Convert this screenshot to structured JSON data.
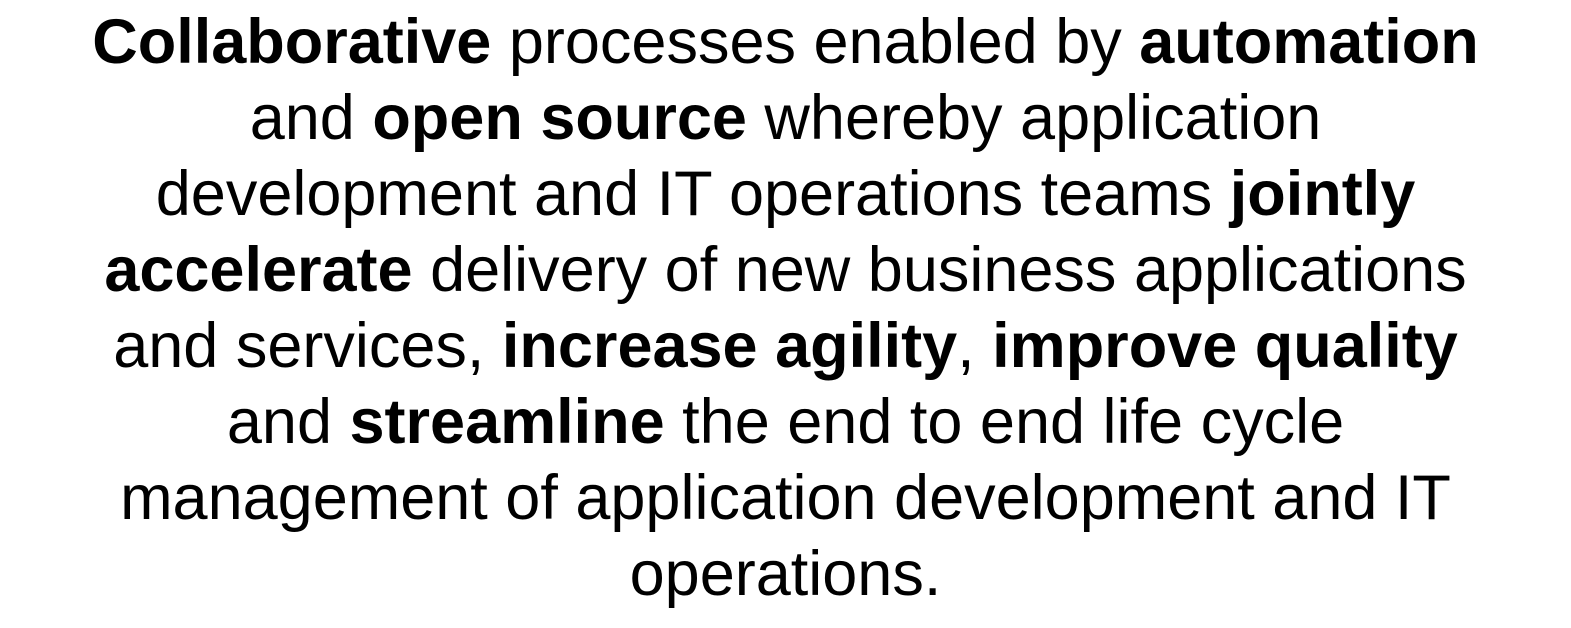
{
  "paragraph": {
    "lines": [
      [
        {
          "text": "Collaborative",
          "bold": true
        },
        {
          "text": " processes enabled by ",
          "bold": false
        },
        {
          "text": "automation",
          "bold": true
        }
      ],
      [
        {
          "text": "and ",
          "bold": false
        },
        {
          "text": "open source",
          "bold": true
        },
        {
          "text": " whereby application",
          "bold": false
        }
      ],
      [
        {
          "text": "development and IT operations teams ",
          "bold": false
        },
        {
          "text": "jointly",
          "bold": true
        }
      ],
      [
        {
          "text": "accelerate",
          "bold": true
        },
        {
          "text": " delivery of new business applications",
          "bold": false
        }
      ],
      [
        {
          "text": "and services, ",
          "bold": false
        },
        {
          "text": "increase agility",
          "bold": true
        },
        {
          "text": ", ",
          "bold": false
        },
        {
          "text": "improve quality",
          "bold": true
        }
      ],
      [
        {
          "text": "and ",
          "bold": false
        },
        {
          "text": "streamline",
          "bold": true
        },
        {
          "text": " the end to end life cycle",
          "bold": false
        }
      ],
      [
        {
          "text": "management of application development and IT",
          "bold": false
        }
      ],
      [
        {
          "text": "operations.",
          "bold": false
        }
      ]
    ]
  }
}
